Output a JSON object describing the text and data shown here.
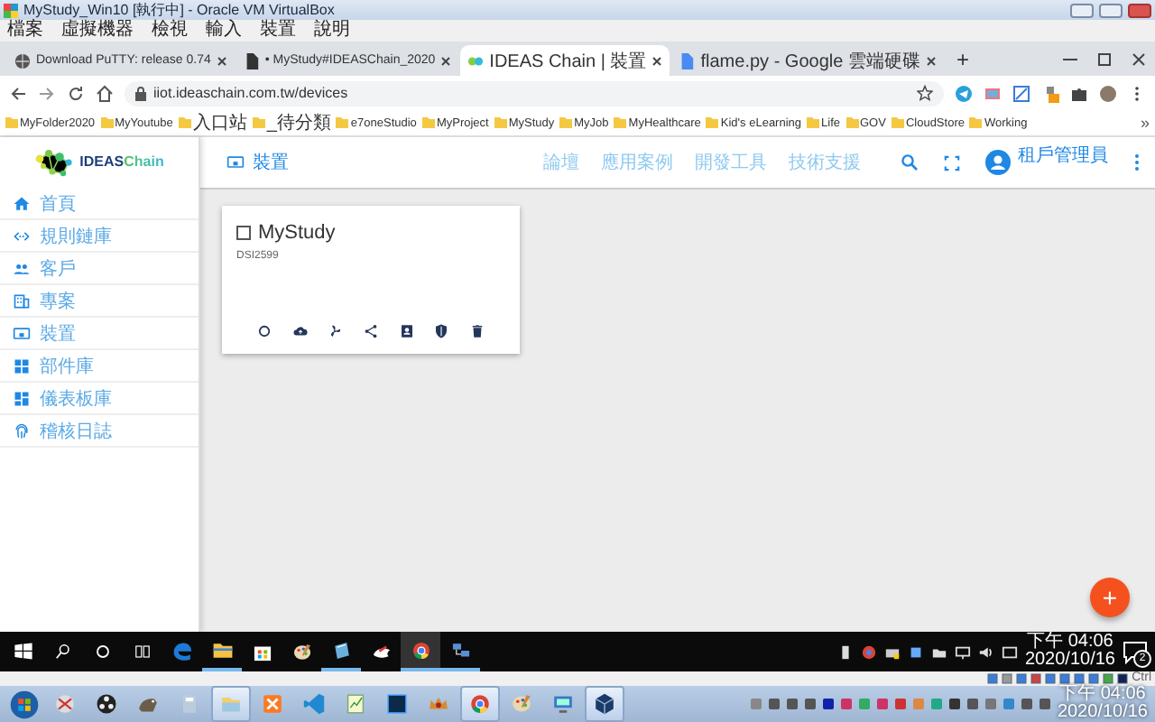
{
  "vbox": {
    "title": "MyStudy_Win10 [執行中] - Oracle VM VirtualBox",
    "menu": [
      "檔案",
      "虛擬機器",
      "檢視",
      "輸入",
      "裝置",
      "說明"
    ]
  },
  "browser": {
    "tabs": [
      {
        "title": "Download PuTTY: release 0.74",
        "selected": false
      },
      {
        "title": "• MyStudy#IDEASChain_2020",
        "selected": false
      },
      {
        "title": "IDEAS Chain | 裝置",
        "selected": true
      },
      {
        "title": "flame.py - Google 雲端硬碟",
        "selected": false
      }
    ],
    "new_tab": "+",
    "address": "iiot.ideaschain.com.tw/devices",
    "bookmarks": [
      "MyFolder2020",
      "MyYoutube",
      "入口站",
      "_待分類",
      "e7oneStudio",
      "MyProject",
      "MyStudy",
      "MyJob",
      "MyHealthcare",
      "Kid's eLearning",
      "Life",
      "GOV",
      "CloudStore",
      "Working"
    ],
    "bookmarks_more": "»"
  },
  "app": {
    "logo": "IDEASChain",
    "page_title": "裝置",
    "nav": [
      "論壇",
      "應用案例",
      "開發工具",
      "技術支援"
    ],
    "user": "租戶管理員",
    "sidebar": {
      "items": [
        {
          "label": "首頁",
          "selected": false
        },
        {
          "label": "規則鏈庫",
          "selected": false
        },
        {
          "label": "客戶",
          "selected": false
        },
        {
          "label": "專案",
          "selected": false
        },
        {
          "label": "裝置",
          "selected": false
        },
        {
          "label": "部件庫",
          "selected": false
        },
        {
          "label": "儀表板庫",
          "selected": false
        },
        {
          "label": "稽核日誌",
          "selected": false
        }
      ]
    },
    "devices": [
      {
        "name": "MyStudy",
        "checked": false,
        "label": "DSI2599"
      }
    ],
    "fab": "+"
  },
  "win10_taskbar": {
    "apps": [
      {
        "running": false,
        "selected": false
      },
      {
        "running": true,
        "selected": false
      },
      {
        "running": false,
        "selected": false
      },
      {
        "running": false,
        "selected": false
      },
      {
        "running": true,
        "selected": false
      },
      {
        "running": false,
        "selected": false
      },
      {
        "running": true,
        "selected": true
      },
      {
        "running": true,
        "selected": false
      }
    ],
    "time": "下午 04:06",
    "date": "2020/10/16",
    "notifications": "2"
  },
  "vbox_status": {
    "host_key": "Ctrl"
  },
  "win7_taskbar": {
    "apps": [
      {
        "running": false
      },
      {
        "running": false
      },
      {
        "running": false
      },
      {
        "running": false
      },
      {
        "running": true
      },
      {
        "running": false
      },
      {
        "running": false
      },
      {
        "running": false
      },
      {
        "running": false
      },
      {
        "running": false
      },
      {
        "running": true
      },
      {
        "running": false
      },
      {
        "running": false
      },
      {
        "running": true
      }
    ],
    "time": "下午 04:06",
    "date": "2020/10/16"
  }
}
